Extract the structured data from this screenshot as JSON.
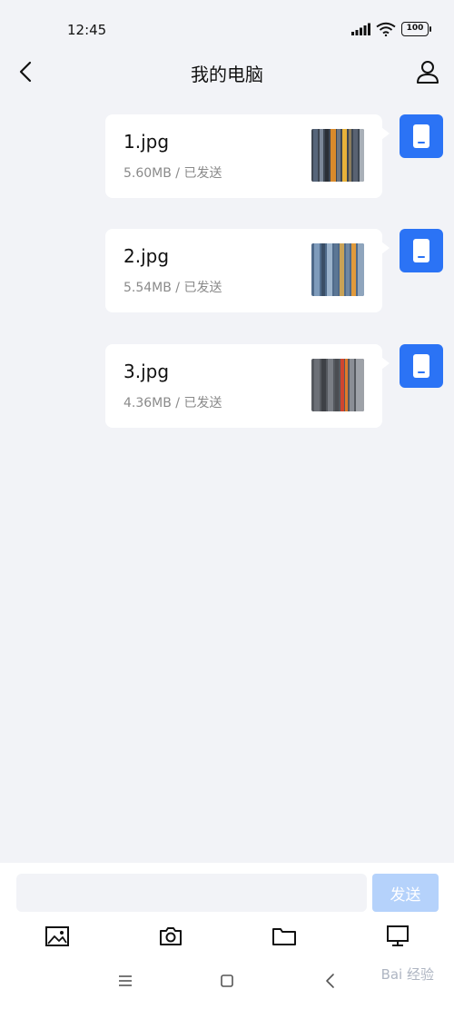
{
  "status_bar": {
    "time": "12:45",
    "battery": "100"
  },
  "header": {
    "title": "我的电脑"
  },
  "messages": [
    {
      "file_name": "1.jpg",
      "meta": "5.60MB / 已发送"
    },
    {
      "file_name": "2.jpg",
      "meta": "5.54MB / 已发送"
    },
    {
      "file_name": "3.jpg",
      "meta": "4.36MB / 已发送"
    }
  ],
  "input": {
    "value": "",
    "send_label": "发送"
  },
  "colors": {
    "accent": "#2b73f5",
    "send_disabled": "#b5d2fb",
    "background": "#f2f3f7"
  },
  "watermark": "Bai 经验"
}
